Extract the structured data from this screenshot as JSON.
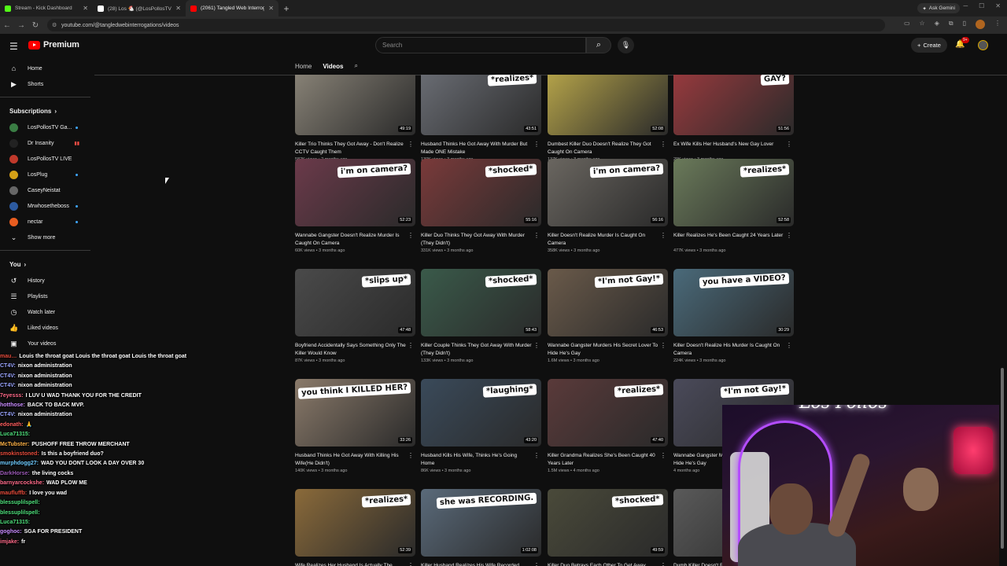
{
  "browser": {
    "tabs": [
      {
        "title": "Stream - Kick Dashboard",
        "color": "#53fc18"
      },
      {
        "title": "(28) Los 🐔 (@LosPollosTV) / X",
        "color": "#ffffff"
      },
      {
        "title": "(2061) Tangled Web Interrogati...",
        "color": "#ff0000"
      }
    ],
    "new_tab": "+",
    "gemini": "Ask Gemini",
    "url": "youtube.com/@tangledwebinterrogations/videos"
  },
  "yt": {
    "logo": "Premium",
    "search_placeholder": "Search",
    "create": "Create",
    "notif_badge": "9+"
  },
  "sidebar": {
    "home": "Home",
    "shorts": "Shorts",
    "subscriptions": "Subscriptions",
    "channels": [
      {
        "name": "LosPollosTV Ga...",
        "color": "#3a7d44",
        "marker": "dot"
      },
      {
        "name": "Dr Insanity",
        "color": "#222222",
        "marker": "live"
      },
      {
        "name": "LosPollosTV LIVE",
        "color": "#c0392b",
        "marker": ""
      },
      {
        "name": "LosPlug",
        "color": "#d4a017",
        "marker": "dot"
      },
      {
        "name": "CaseyNeistat",
        "color": "#666666",
        "marker": ""
      },
      {
        "name": "Mrwhosetheboss",
        "color": "#2c5aa0",
        "marker": "dot"
      },
      {
        "name": "nectar",
        "color": "#e85d20",
        "marker": "dot"
      }
    ],
    "show_more": "Show more",
    "you": "You",
    "you_items": [
      "History",
      "Playlists",
      "Watch later",
      "Liked videos",
      "Your videos"
    ]
  },
  "channel_tabs": [
    "Home",
    "Videos"
  ],
  "videos": [
    {
      "title": "Killer Trio Thinks They Got Away - Don't Realize CCTV Caught Them",
      "meta": "582K views • 2 months ago",
      "duration": "49:19",
      "caption": "",
      "bg": "#8a8478"
    },
    {
      "title": "Husband Thinks He Got Away With Murder But Made ONE Mistake",
      "meta": "130K views • 3 months ago",
      "duration": "43:51",
      "caption": "*realizes*",
      "bg": "#6b6e75"
    },
    {
      "title": "Dumbest Killer Duo Doesn't Realize They Got Caught On Camera",
      "meta": "137K views • 3 months ago",
      "duration": "52:08",
      "caption": "",
      "bg": "#b8a64a"
    },
    {
      "title": "Ex Wife Kills Her Husband's New Gay Lover",
      "meta": "29K views • 3 months ago",
      "duration": "51:56",
      "caption": "GAY?",
      "bg": "#9a3a3e"
    },
    {
      "title": "Wannabe Gangster Doesn't Realize Murder Is Caught On Camera",
      "meta": "60K views • 3 months ago",
      "duration": "52:23",
      "caption": "i'm on camera?",
      "bg": "#6b3a4a"
    },
    {
      "title": "Killer Duo Thinks They Got Away With Murder (They Didn't)",
      "meta": "331K views • 3 months ago",
      "duration": "55:16",
      "caption": "*shocked*",
      "bg": "#7a3a3a"
    },
    {
      "title": "Killer Doesn't Realize Murder Is Caught On Camera",
      "meta": "358K views • 3 months ago",
      "duration": "56:16",
      "caption": "i'm on camera?",
      "bg": "#6a6660"
    },
    {
      "title": "Killer Realizes He's Been Caught 24 Years Later",
      "meta": "477K views • 3 months ago",
      "duration": "52:58",
      "caption": "*realizes*",
      "bg": "#6a7a5a"
    },
    {
      "title": "Boyfriend Accidentally Says Something Only The Killer Would Know",
      "meta": "87K views • 3 months ago",
      "duration": "47:48",
      "caption": "*slips up*",
      "bg": "#4a4a4a"
    },
    {
      "title": "Killer Couple Thinks They Got Away With Murder (They Didn't)",
      "meta": "133K views • 3 months ago",
      "duration": "58:43",
      "caption": "*shocked*",
      "bg": "#3a5a4a"
    },
    {
      "title": "Wannabe Gangster Murders His Secret Lover To Hide He's Gay",
      "meta": "1.6M views • 3 months ago",
      "duration": "46:53",
      "caption": "*I'm not Gay!*",
      "bg": "#6a5a4a"
    },
    {
      "title": "Killer Doesn't Realize His Murder Is Caught On Camera",
      "meta": "224K views • 3 months ago",
      "duration": "30:29",
      "caption": "you have a VIDEO?",
      "bg": "#4a6a7a"
    },
    {
      "title": "Husband Thinks He Got Away With Killing His Wife(He Didn't)",
      "meta": "140K views • 3 months ago",
      "duration": "33:26",
      "caption": "you think I KILLED HER?",
      "bg": "#8a7a6a"
    },
    {
      "title": "Husband Kills His Wife, Thinks He's Going Home",
      "meta": "86K views • 3 months ago",
      "duration": "43:20",
      "caption": "*laughing*",
      "bg": "#3a4a5a"
    },
    {
      "title": "Killer Grandma Realizes She's Been Caught 40 Years Later",
      "meta": "1.5M views • 4 months ago",
      "duration": "47:40",
      "caption": "*realizes*",
      "bg": "#5a3a3a"
    },
    {
      "title": "Wannabe Gangster Murders His Secret Lover To Hide He's Gay",
      "meta": "4 months ago",
      "duration": "",
      "caption": "*I'm not Gay!*",
      "bg": "#4a4a5a"
    },
    {
      "title": "Wife Realizes Her Husband Is Actually The",
      "meta": "",
      "duration": "52:39",
      "caption": "*realizes*",
      "bg": "#8a6a3a"
    },
    {
      "title": "Killer Husband Realizes His Wife Recorded",
      "meta": "",
      "duration": "1:02:08",
      "caption": "she was RECORDING.",
      "bg": "#5a6a7a"
    },
    {
      "title": "Killer Duo Betrays Each Other To Get Away",
      "meta": "",
      "duration": "49:59",
      "caption": "*shocked*",
      "bg": "#4a4a3a"
    },
    {
      "title": "Dumb Killer Doesn't Realize He Got Caught",
      "meta": "",
      "duration": "",
      "caption": "",
      "bg": "#5a5a5a"
    }
  ],
  "chat": [
    {
      "user": "mau…",
      "ucolor": "#e74c3c",
      "msg": "Louis the throat goat Louis the throat goat Louis the throat goat"
    },
    {
      "user": "CT4V:",
      "ucolor": "#9aa5ff",
      "msg": "nixon administration"
    },
    {
      "user": "CT4V:",
      "ucolor": "#9aa5ff",
      "msg": "nixon administration"
    },
    {
      "user": "CT4V:",
      "ucolor": "#9aa5ff",
      "msg": "nixon administration"
    },
    {
      "user": "7eyesss:",
      "ucolor": "#ff6b8a",
      "msg": "I LUV U WAD THANK YOU FOR THE CREDIT"
    },
    {
      "user": "hotthose:",
      "ucolor": "#c98cff",
      "msg": "BACK TO BACK MVP."
    },
    {
      "user": "CT4V:",
      "ucolor": "#9aa5ff",
      "msg": "nixon administration"
    },
    {
      "user": "edonath:",
      "ucolor": "#ff5e5e",
      "msg": "🙏"
    },
    {
      "user": "Luca71315:",
      "ucolor": "#4ee07b",
      "msg": ""
    },
    {
      "user": "McTubster:",
      "ucolor": "#ffb347",
      "msg": "PUSHOFF FREE THROW MERCHANT"
    },
    {
      "user": "smokinstoned:",
      "ucolor": "#e74c3c",
      "msg": "Is this a boyfriend duo?"
    },
    {
      "user": "murphdogg27:",
      "ucolor": "#6ecbff",
      "msg": "WAD YOU DONT LOOK A DAY OVER 30"
    },
    {
      "user": "DarkHorse:",
      "ucolor": "#9b59b6",
      "msg": "the living cocks"
    },
    {
      "user": "barnyarcockshe:",
      "ucolor": "#ff6b8a",
      "msg": "WAD PLOW ME"
    },
    {
      "user": "maufluffb:",
      "ucolor": "#e74c3c",
      "msg": "I love you wad"
    },
    {
      "user": "blessuplilspell:",
      "ucolor": "#4ee07b",
      "msg": ""
    },
    {
      "user": "blessuplilspell:",
      "ucolor": "#4ee07b",
      "msg": ""
    },
    {
      "user": "Luca71315:",
      "ucolor": "#4ee07b",
      "msg": ""
    },
    {
      "user": "goghoc:",
      "ucolor": "#c98cff",
      "msg": "SGA FOR PRESIDENT"
    },
    {
      "user": "imjake:",
      "ucolor": "#ff6b8a",
      "msg": "fr"
    }
  ],
  "cam": {
    "sign": "Los Pollos"
  }
}
